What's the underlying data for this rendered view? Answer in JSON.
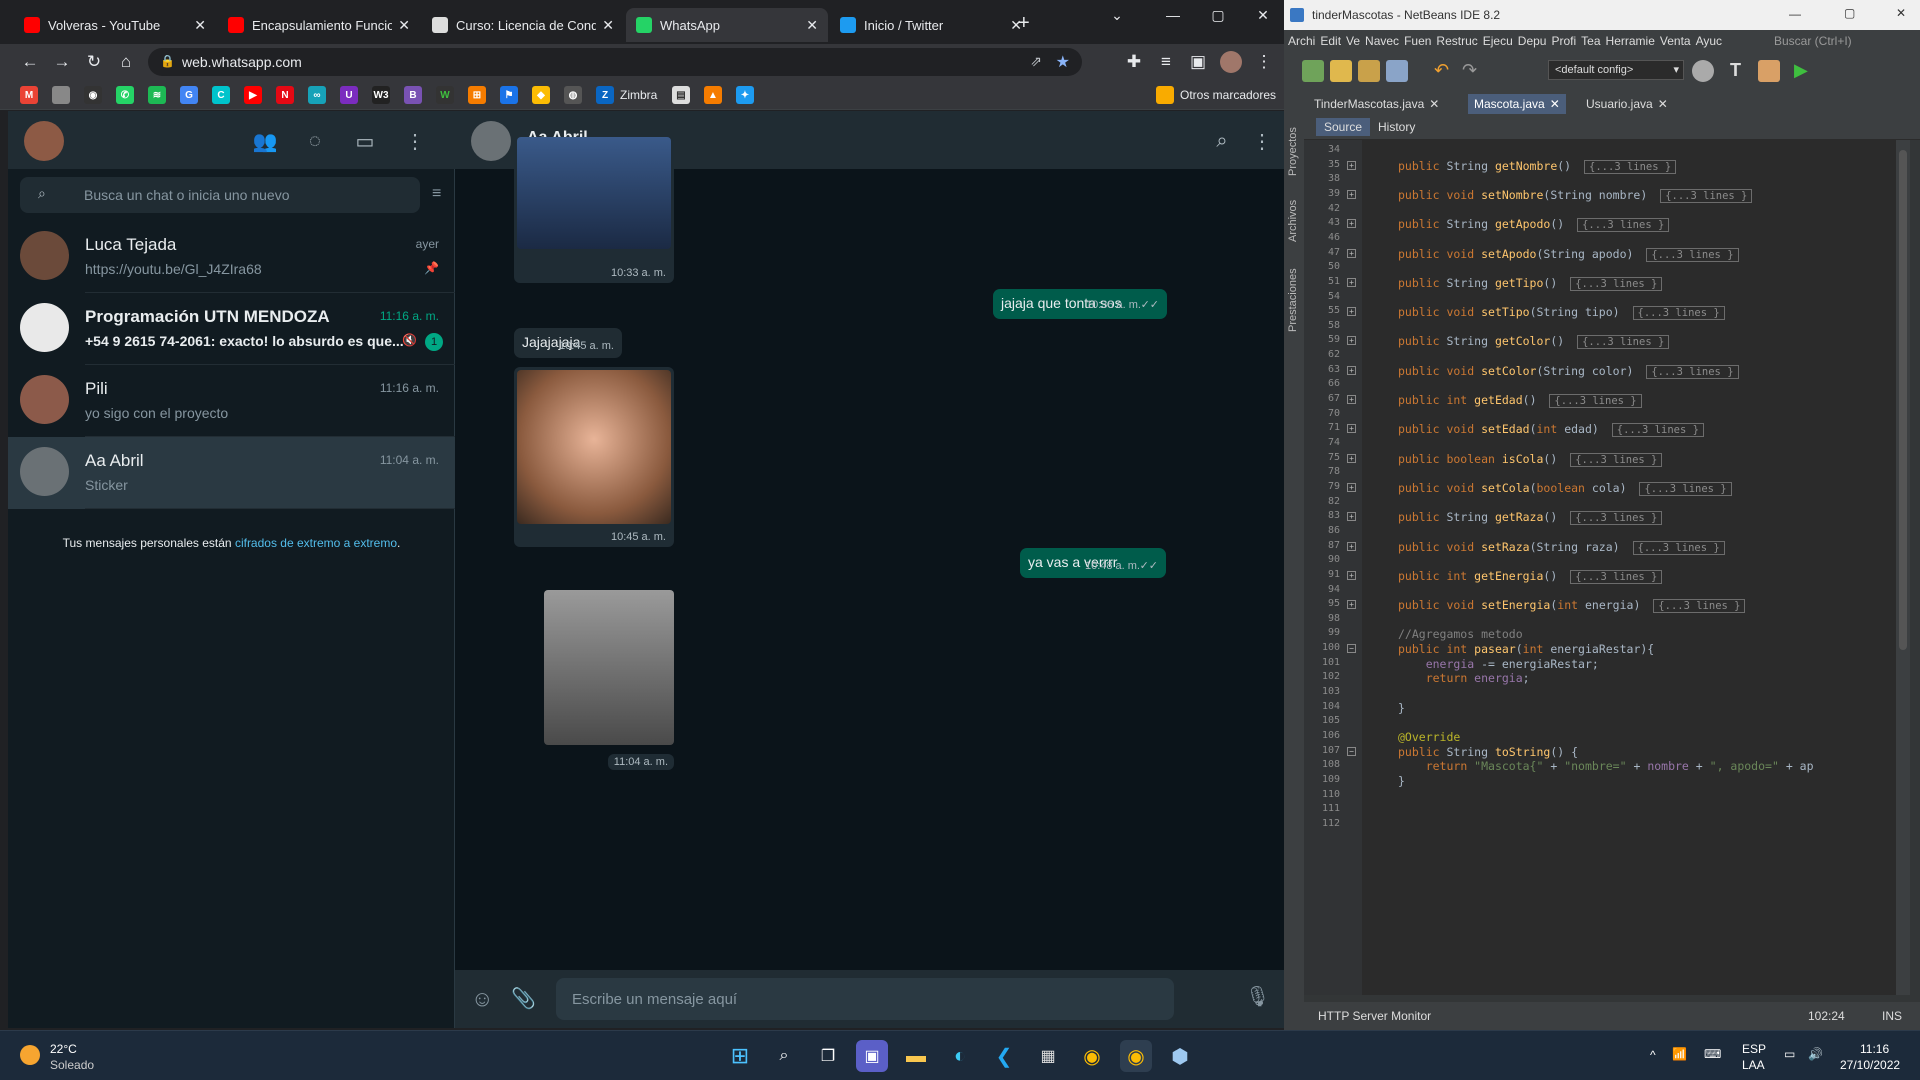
{
  "browser": {
    "tabs": [
      {
        "title": "Volveras - YouTube",
        "color": "#ff0000"
      },
      {
        "title": "Encapsulamiento Funcion",
        "color": "#ff0000"
      },
      {
        "title": "Curso: Licencia de Condu",
        "color": "#dddddd"
      },
      {
        "title": "WhatsApp",
        "color": "#25d366"
      },
      {
        "title": "Inicio / Twitter",
        "color": "#1d9bf0"
      }
    ],
    "url": "web.whatsapp.com",
    "bookmarks_zimbra": "Zimbra",
    "bookmarks_other": "Otros marcadores"
  },
  "whatsapp": {
    "search_placeholder": "Busca un chat o inicia uno nuevo",
    "chats": [
      {
        "name": "Luca Tejada",
        "time": "ayer",
        "preview": "https://youtu.be/Gl_J4ZIra68"
      },
      {
        "name": "Programación UTN MENDOZA",
        "time": "11:16 a. m.",
        "preview": "+54 9 2615 74-2061: exacto! lo absurdo es que...",
        "unread": "1"
      },
      {
        "name": "Pili",
        "time": "11:16 a. m.",
        "preview": "yo sigo con el proyecto"
      },
      {
        "name": "Aa Abril",
        "time": "11:04 a. m.",
        "preview": "Sticker"
      }
    ],
    "encryption_text": "Tus mensajes personales están ",
    "encryption_link": "cifrados de extremo a extremo",
    "encryption_end": ".",
    "conversation": {
      "contact": "Aa Abril",
      "messages": [
        {
          "time": "10:33 a. m."
        },
        {
          "text": "jajaja que tonta sos",
          "time": "10:36 a. m."
        },
        {
          "text": "Jajajajaja",
          "time": "10:45 a. m."
        },
        {
          "time": "10:45 a. m."
        },
        {
          "text": "ya vas a verrrr",
          "time": "10:48 a. m."
        },
        {
          "time": "11:04 a. m."
        }
      ]
    },
    "composer_placeholder": "Escribe un mensaje aquí"
  },
  "netbeans": {
    "title": "tinderMascotas - NetBeans IDE 8.2",
    "menu": [
      "Archi",
      "Edit",
      "Ve",
      "Navec",
      "Fuen",
      "Restruc",
      "Ejecu",
      "Depu",
      "Profi",
      "Tea",
      "Herramie",
      "Venta",
      "Ayuc"
    ],
    "search": "Buscar (Ctrl+I)",
    "config": "<default config>",
    "side_panels": [
      "Proyectos",
      "Archivos",
      "Prestaciones"
    ],
    "tabs": [
      "TinderMascotas.java",
      "Mascota.java",
      "Usuario.java"
    ],
    "source_label": "Source",
    "history_label": "History",
    "collapsed_label": "{...3 lines }",
    "code_lines": [
      {
        "n": "34",
        "seg": []
      },
      {
        "n": "35",
        "seg": [
          [
            "kw",
            "public "
          ],
          [
            "",
            "String "
          ],
          [
            "fn",
            "getNombre"
          ],
          [
            "",
            "() "
          ]
        ],
        "col": true
      },
      {
        "n": "38",
        "seg": []
      },
      {
        "n": "39",
        "seg": [
          [
            "kw",
            "public void "
          ],
          [
            "fn",
            "setNombre"
          ],
          [
            "",
            "(String nombre) "
          ]
        ],
        "col": true
      },
      {
        "n": "42",
        "seg": []
      },
      {
        "n": "43",
        "seg": [
          [
            "kw",
            "public "
          ],
          [
            "",
            "String "
          ],
          [
            "fn",
            "getApodo"
          ],
          [
            "",
            "() "
          ]
        ],
        "col": true
      },
      {
        "n": "46",
        "seg": []
      },
      {
        "n": "47",
        "seg": [
          [
            "kw",
            "public void "
          ],
          [
            "fn",
            "setApodo"
          ],
          [
            "",
            "(String apodo) "
          ]
        ],
        "col": true
      },
      {
        "n": "50",
        "seg": []
      },
      {
        "n": "51",
        "seg": [
          [
            "kw",
            "public "
          ],
          [
            "",
            "String "
          ],
          [
            "fn",
            "getTipo"
          ],
          [
            "",
            "() "
          ]
        ],
        "col": true
      },
      {
        "n": "54",
        "seg": []
      },
      {
        "n": "55",
        "seg": [
          [
            "kw",
            "public void "
          ],
          [
            "fn",
            "setTipo"
          ],
          [
            "",
            "(String tipo) "
          ]
        ],
        "col": true
      },
      {
        "n": "58",
        "seg": []
      },
      {
        "n": "59",
        "seg": [
          [
            "kw",
            "public "
          ],
          [
            "",
            "String "
          ],
          [
            "fn",
            "getColor"
          ],
          [
            "",
            "() "
          ]
        ],
        "col": true
      },
      {
        "n": "62",
        "seg": []
      },
      {
        "n": "63",
        "seg": [
          [
            "kw",
            "public void "
          ],
          [
            "fn",
            "setColor"
          ],
          [
            "",
            "(String color) "
          ]
        ],
        "col": true
      },
      {
        "n": "66",
        "seg": []
      },
      {
        "n": "67",
        "seg": [
          [
            "kw",
            "public int "
          ],
          [
            "fn",
            "getEdad"
          ],
          [
            "",
            "() "
          ]
        ],
        "col": true
      },
      {
        "n": "70",
        "seg": []
      },
      {
        "n": "71",
        "seg": [
          [
            "kw",
            "public void "
          ],
          [
            "fn",
            "setEdad"
          ],
          [
            "",
            "("
          ],
          [
            "kw",
            "int "
          ],
          [
            "",
            "edad) "
          ]
        ],
        "col": true
      },
      {
        "n": "74",
        "seg": []
      },
      {
        "n": "75",
        "seg": [
          [
            "kw",
            "public boolean "
          ],
          [
            "fn",
            "isCola"
          ],
          [
            "",
            "() "
          ]
        ],
        "col": true
      },
      {
        "n": "78",
        "seg": []
      },
      {
        "n": "79",
        "seg": [
          [
            "kw",
            "public void "
          ],
          [
            "fn",
            "setCola"
          ],
          [
            "",
            "("
          ],
          [
            "kw",
            "boolean "
          ],
          [
            "",
            "cola) "
          ]
        ],
        "col": true
      },
      {
        "n": "82",
        "seg": []
      },
      {
        "n": "83",
        "seg": [
          [
            "kw",
            "public "
          ],
          [
            "",
            "String "
          ],
          [
            "fn",
            "getRaza"
          ],
          [
            "",
            "() "
          ]
        ],
        "col": true
      },
      {
        "n": "86",
        "seg": []
      },
      {
        "n": "87",
        "seg": [
          [
            "kw",
            "public void "
          ],
          [
            "fn",
            "setRaza"
          ],
          [
            "",
            "(String raza) "
          ]
        ],
        "col": true
      },
      {
        "n": "90",
        "seg": []
      },
      {
        "n": "91",
        "seg": [
          [
            "kw",
            "public int "
          ],
          [
            "fn",
            "getEnergia"
          ],
          [
            "",
            "() "
          ]
        ],
        "col": true
      },
      {
        "n": "94",
        "seg": []
      },
      {
        "n": "95",
        "seg": [
          [
            "kw",
            "public void "
          ],
          [
            "fn",
            "setEnergia"
          ],
          [
            "",
            "("
          ],
          [
            "kw",
            "int "
          ],
          [
            "",
            "energia) "
          ]
        ],
        "col": true
      },
      {
        "n": "98",
        "seg": []
      },
      {
        "n": "99",
        "seg": [
          [
            "cm",
            "//Agregamos metodo"
          ]
        ]
      },
      {
        "n": "100",
        "seg": [
          [
            "kw",
            "public int "
          ],
          [
            "fn",
            "pasear"
          ],
          [
            "",
            "("
          ],
          [
            "kw",
            "int "
          ],
          [
            "",
            "energiaRestar){"
          ]
        ]
      },
      {
        "n": "101",
        "seg": [
          [
            "",
            "    "
          ],
          [
            "fld",
            "energia"
          ],
          [
            "",
            " -= energiaRestar;"
          ]
        ]
      },
      {
        "n": "102",
        "seg": [
          [
            "",
            "    "
          ],
          [
            "kw",
            "return "
          ],
          [
            "fld",
            "energia"
          ],
          [
            "",
            ";"
          ]
        ]
      },
      {
        "n": "103",
        "seg": []
      },
      {
        "n": "104",
        "seg": [
          [
            "",
            "}"
          ]
        ]
      },
      {
        "n": "105",
        "seg": []
      },
      {
        "n": "106",
        "seg": [
          [
            "ann",
            "@Override"
          ]
        ]
      },
      {
        "n": "107",
        "seg": [
          [
            "kw",
            "public "
          ],
          [
            "",
            "String "
          ],
          [
            "fn",
            "toString"
          ],
          [
            "",
            "() {"
          ]
        ]
      },
      {
        "n": "108",
        "seg": [
          [
            "",
            "    "
          ],
          [
            "kw",
            "return "
          ],
          [
            "str",
            "\"Mascota{\" "
          ],
          [
            "",
            "+ "
          ],
          [
            "str",
            "\"nombre=\" "
          ],
          [
            "",
            "+ "
          ],
          [
            "fld",
            "nombre "
          ],
          [
            "",
            "+ "
          ],
          [
            "str",
            "\", apodo=\" "
          ],
          [
            "",
            "+ ap"
          ]
        ]
      },
      {
        "n": "109",
        "seg": [
          [
            "",
            "}"
          ]
        ]
      },
      {
        "n": "110",
        "seg": []
      },
      {
        "n": "111",
        "seg": []
      },
      {
        "n": "112",
        "seg": []
      }
    ],
    "status_left": "HTTP Server Monitor",
    "status_pos": "102:24",
    "status_mode": "INS"
  },
  "taskbar": {
    "temp": "22°C",
    "weather": "Soleado",
    "lang1": "ESP",
    "lang2": "LAA",
    "time": "11:16",
    "date": "27/10/2022"
  }
}
